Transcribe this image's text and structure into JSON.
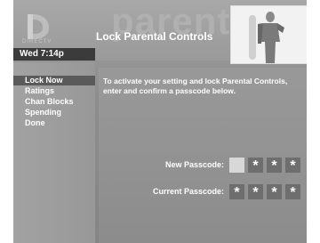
{
  "header": {
    "brand": "DIRECTV",
    "watermark": "parental",
    "time": "Wed 7:14p",
    "title": "Lock Parental Controls"
  },
  "menu": {
    "items": [
      {
        "label": "Lock Now",
        "selected": true
      },
      {
        "label": "Ratings",
        "selected": false
      },
      {
        "label": "Chan Blocks",
        "selected": false
      },
      {
        "label": "Spending",
        "selected": false
      },
      {
        "label": "Done",
        "selected": false
      }
    ]
  },
  "main": {
    "instructions": "To activate your setting and lock Parental Controls, enter and confirm a passcode below.",
    "new_passcode": {
      "label": "New Passcode:",
      "digits": [
        "",
        "*",
        "*",
        "*"
      ]
    },
    "current_passcode": {
      "label": "Current Passcode:",
      "digits": [
        "*",
        "*",
        "*",
        "*"
      ]
    }
  },
  "colors": {
    "selected_menu": "#5a5a5a",
    "passcode_box": "#6e6e6e",
    "passcode_box_active": "#d8d8d8"
  }
}
